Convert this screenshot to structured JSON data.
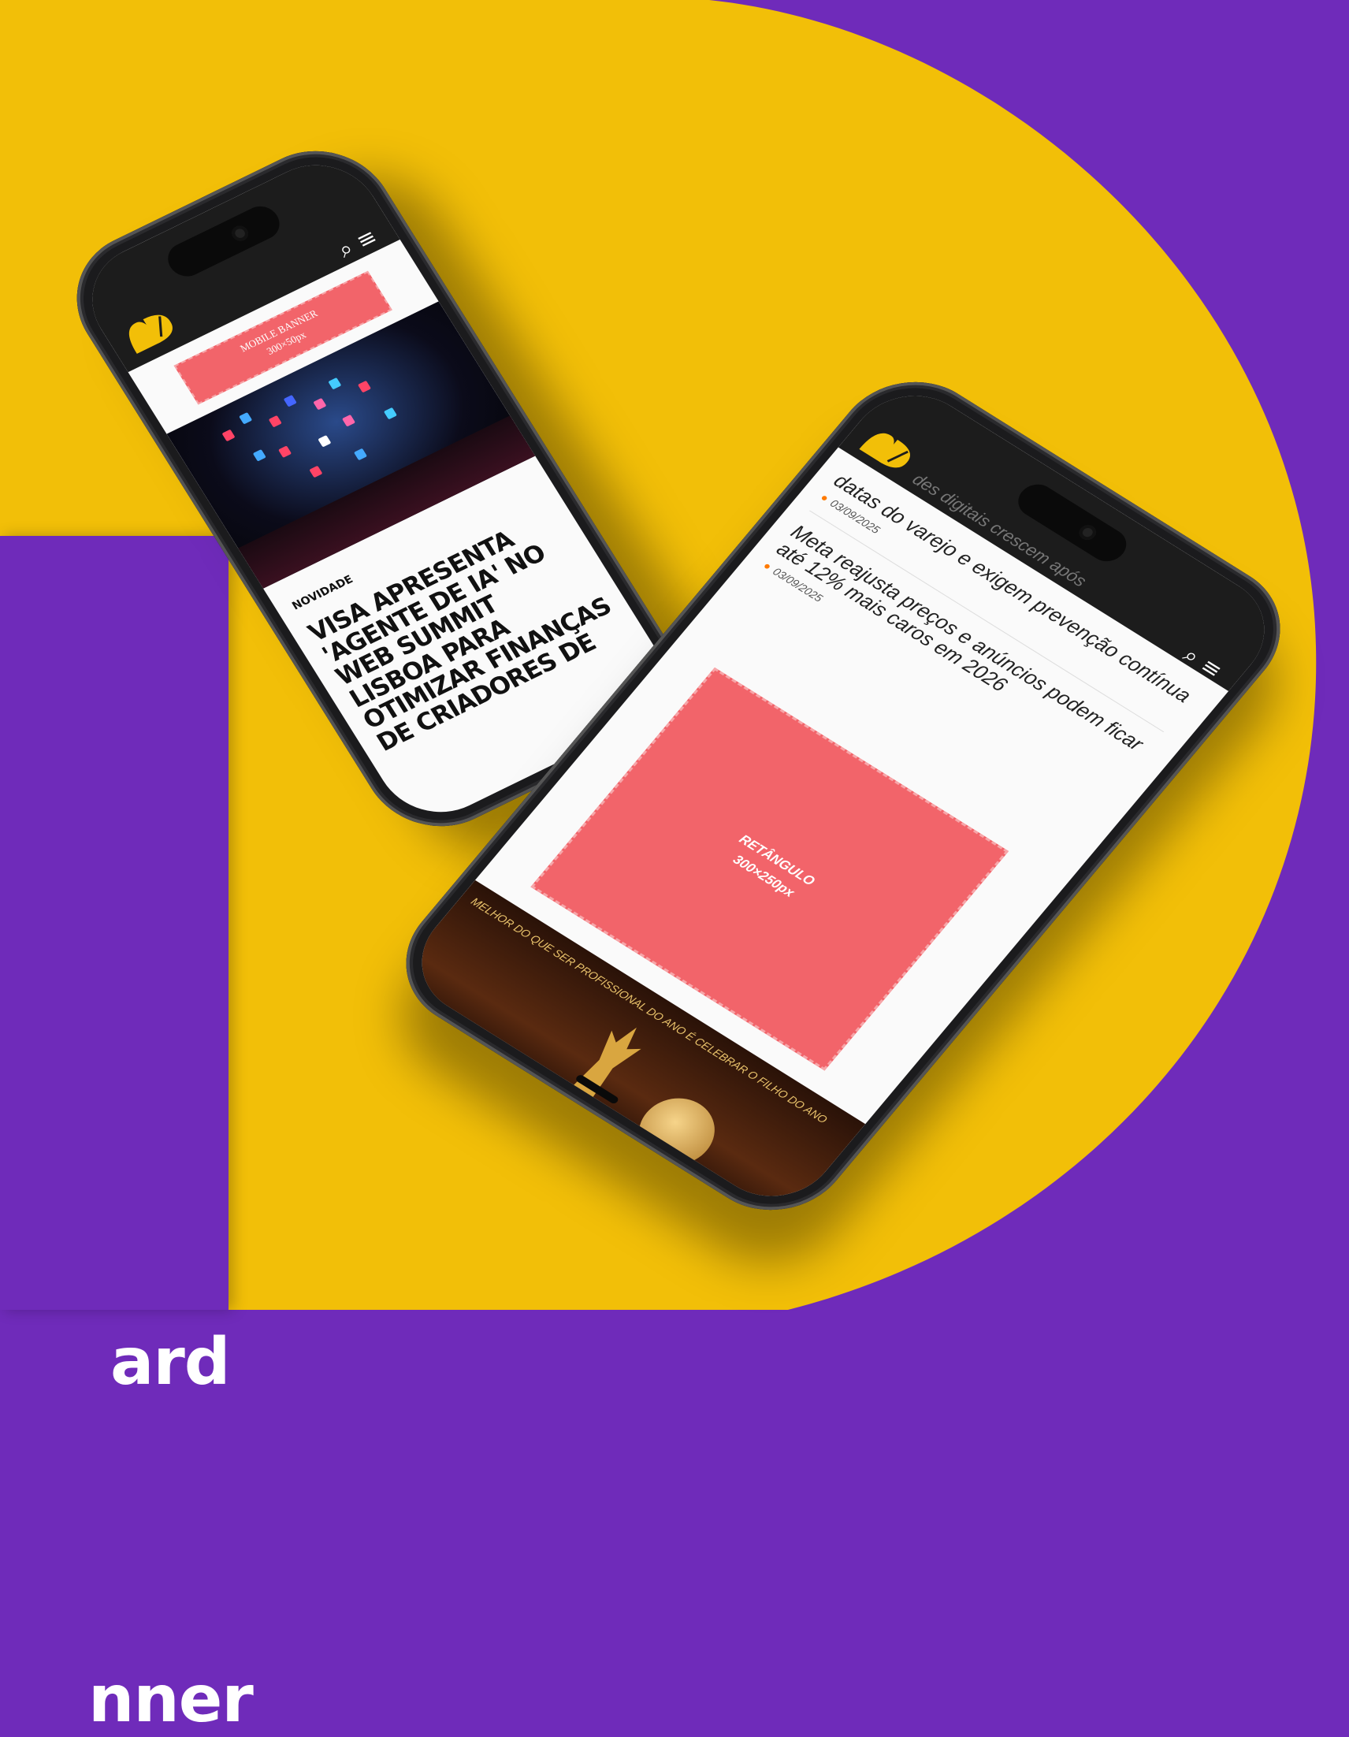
{
  "colors": {
    "purple": "#6F2BBA",
    "yellow": "#F2BF08",
    "banner": "#F2646A",
    "dark": "#1C1C1C"
  },
  "card": {
    "line1": "ard",
    "line2": "nner"
  },
  "phone1": {
    "banner": {
      "line1": "MOBILE BANNER",
      "line2": "300×50px"
    },
    "tag": "NOVIDADE",
    "headline": "VISA APRESENTA 'AGENTE DE IA' NO WEB SUMMIT LISBOA PARA OTIMIZAR FINANÇAS DE CRIADORES DE",
    "icons": [
      "search-icon",
      "menu-icon"
    ]
  },
  "phone2": {
    "partial_title": "des digitais crescem após",
    "items": [
      {
        "title": "datas do varejo e exigem prevenção contínua",
        "date": "03/09/2025"
      },
      {
        "title": "Meta reajusta preços e anúncios podem ficar até 12% mais caros em 2026",
        "date": "03/09/2025"
      }
    ],
    "rect": {
      "line1": "RETÂNGULO",
      "line2": "300×250px"
    },
    "award_text": "MELHOR DO QUE SER PROFISSIONAL DO ANO É CELEBRAR O FILHO DO ANO",
    "icons": [
      "search-icon",
      "menu-icon"
    ]
  }
}
